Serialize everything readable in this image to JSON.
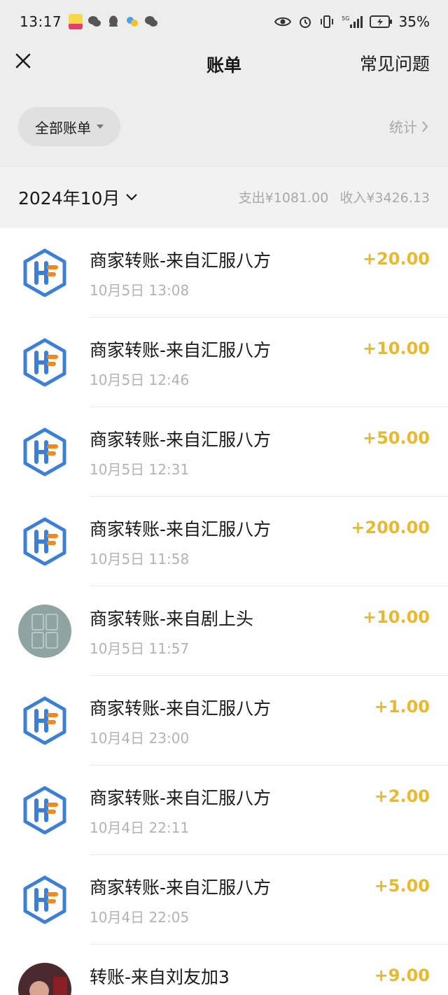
{
  "status_bar": {
    "time": "13:17",
    "battery": "35%",
    "network": "5G"
  },
  "header": {
    "title": "账单",
    "faq": "常见问题"
  },
  "filter": {
    "label": "全部账单",
    "stats": "统计"
  },
  "month_bar": {
    "month": "2024年10月",
    "expense": "支出¥1081.00",
    "income": "收入¥3426.13"
  },
  "colors": {
    "amount": "#e8b92c",
    "logo_blue": "#3b7fd6",
    "logo_orange": "#f08a1c"
  },
  "transactions": [
    {
      "title": "商家转账-来自汇服八方",
      "time": "10月5日 13:08",
      "amount": "+20.00",
      "icon": "hf-logo-icon"
    },
    {
      "title": "商家转账-来自汇服八方",
      "time": "10月5日 12:46",
      "amount": "+10.00",
      "icon": "hf-logo-icon"
    },
    {
      "title": "商家转账-来自汇服八方",
      "time": "10月5日 12:31",
      "amount": "+50.00",
      "icon": "hf-logo-icon"
    },
    {
      "title": "商家转账-来自汇服八方",
      "time": "10月5日 11:58",
      "amount": "+200.00",
      "icon": "hf-logo-icon"
    },
    {
      "title": "商家转账-来自剧上头",
      "time": "10月5日 11:57",
      "amount": "+10.00",
      "icon": "app-grid-avatar"
    },
    {
      "title": "商家转账-来自汇服八方",
      "time": "10月4日 23:00",
      "amount": "+1.00",
      "icon": "hf-logo-icon"
    },
    {
      "title": "商家转账-来自汇服八方",
      "time": "10月4日 22:11",
      "amount": "+2.00",
      "icon": "hf-logo-icon"
    },
    {
      "title": "商家转账-来自汇服八方",
      "time": "10月4日 22:05",
      "amount": "+5.00",
      "icon": "hf-logo-icon"
    },
    {
      "title": "转账-来自刘友加3",
      "time": "",
      "amount": "+9.00",
      "icon": "user-photo-avatar"
    }
  ]
}
